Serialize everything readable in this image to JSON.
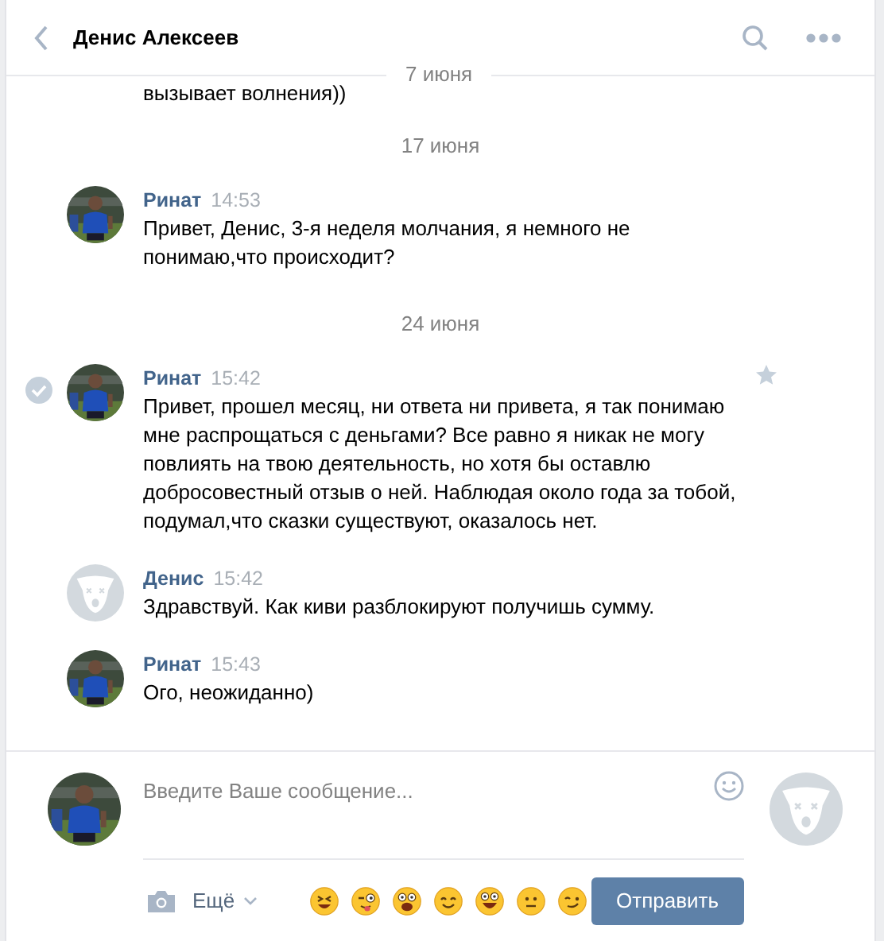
{
  "header": {
    "title": "Денис Алексеев"
  },
  "floating_date": "7 июня",
  "partial_message": "вызывает волнения))",
  "feed": [
    {
      "kind": "date",
      "text": "17 июня"
    },
    {
      "kind": "message",
      "sender": "Ринат",
      "time": "14:53",
      "has_photo": true,
      "hovered": false,
      "text": "Привет, Денис, 3-я неделя молчания, я немного не понимаю,что происходит?"
    },
    {
      "kind": "date",
      "text": "24 июня"
    },
    {
      "kind": "message",
      "sender": "Ринат",
      "time": "15:42",
      "has_photo": true,
      "hovered": true,
      "text": "Привет, прошел месяц, ни ответа ни привета, я так понимаю мне распрощаться с деньгами? Все равно я никак не могу повлиять на твою деятельность, но хотя бы оставлю добросовестный отзыв о ней. Наблюдая около года за тобой, подумал,что сказки существуют, оказалось нет."
    },
    {
      "kind": "message",
      "sender": "Денис",
      "time": "15:42",
      "has_photo": false,
      "hovered": false,
      "text": "Здравствуй. Как киви разблокируют получишь сумму."
    },
    {
      "kind": "message",
      "sender": "Ринат",
      "time": "15:43",
      "has_photo": true,
      "hovered": false,
      "text": "Ого, неожиданно)"
    }
  ],
  "composer": {
    "placeholder": "Введите Ваше сообщение...",
    "more_label": "Ещё",
    "send_label": "Отправить",
    "emojis": [
      {
        "kind": "laughing"
      },
      {
        "kind": "wink_tongue"
      },
      {
        "kind": "shocked"
      },
      {
        "kind": "smile"
      },
      {
        "kind": "grin"
      },
      {
        "kind": "neutral"
      },
      {
        "kind": "wink"
      }
    ]
  }
}
